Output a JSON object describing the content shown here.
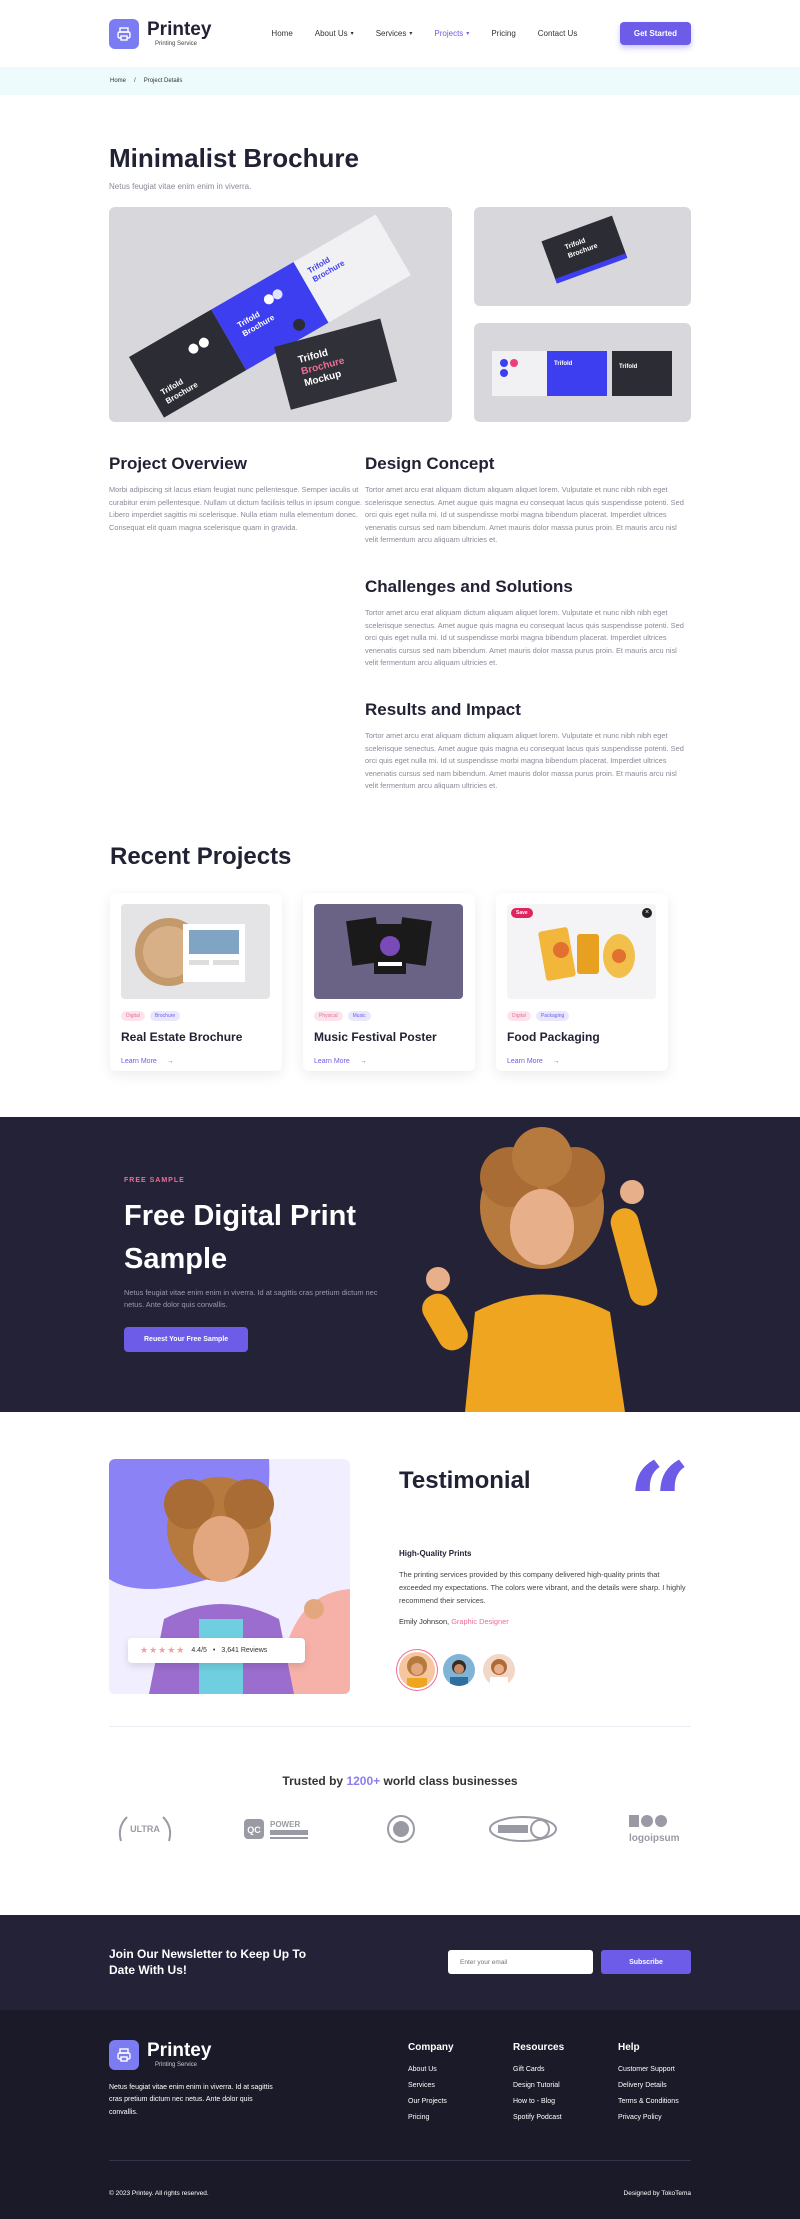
{
  "brand": {
    "name": "Printey",
    "tagline": "Printing Service"
  },
  "nav": {
    "items": [
      {
        "label": "Home",
        "has_dropdown": false,
        "active": false
      },
      {
        "label": "About Us",
        "has_dropdown": true,
        "active": false
      },
      {
        "label": "Services",
        "has_dropdown": true,
        "active": false
      },
      {
        "label": "Projects",
        "has_dropdown": true,
        "active": true
      },
      {
        "label": "Pricing",
        "has_dropdown": false,
        "active": false
      },
      {
        "label": "Contact Us",
        "has_dropdown": false,
        "active": false
      }
    ],
    "cta": "Get Started"
  },
  "breadcrumb": {
    "home": "Home",
    "separator": "/",
    "current": "Project Details"
  },
  "project": {
    "title": "Minimalist Brochure",
    "subtitle": "Netus feugiat vitae enim enim in viverra.",
    "mockup_text": "Trifold Brochure Mockup",
    "overview_title": "Project Overview",
    "overview_text": "Morbi adipiscing sit lacus etiam feugiat nunc pellentesque. Semper iaculis ut curabitur enim pellentesque. Nullam ut dictum facilisis tellus in ipsum congue. Libero imperdiet sagittis mi scelerisque. Nulla etiam nulla elementum donec. Consequat elit quam magna scelerisque quam in gravida.",
    "sections": [
      {
        "title": "Design Concept",
        "text": "Tortor amet arcu erat aliquam dictum aliquam aliquet lorem. Vulputate et nunc nibh nibh eget scelerisque senectus. Amet augue quis magna eu consequat lacus quis suspendisse potenti. Sed orci quis eget nulla mi. Id ut suspendisse morbi magna bibendum placerat. Imperdiet ultrices venenatis cursus sed nam bibendum. Amet mauris dolor massa purus proin. Et mauris arcu nisl velit fermentum arcu aliquam ultricies et."
      },
      {
        "title": "Challenges and Solutions",
        "text": "Tortor amet arcu erat aliquam dictum aliquam aliquet lorem. Vulputate et nunc nibh nibh eget scelerisque senectus. Amet augue quis magna eu consequat lacus quis suspendisse potenti. Sed orci quis eget nulla mi. Id ut suspendisse morbi magna bibendum placerat. Imperdiet ultrices venenatis cursus sed nam bibendum. Amet mauris dolor massa purus proin. Et mauris arcu nisl velit fermentum arcu aliquam ultricies et."
      },
      {
        "title": "Results and Impact",
        "text": "Tortor amet arcu erat aliquam dictum aliquam aliquet lorem. Vulputate et nunc nibh nibh eget scelerisque senectus. Amet augue quis magna eu consequat lacus quis suspendisse potenti. Sed orci quis eget nulla mi. Id ut suspendisse morbi magna bibendum placerat. Imperdiet ultrices venenatis cursus sed nam bibendum. Amet mauris dolor massa purus proin. Et mauris arcu nisl velit fermentum arcu aliquam ultricies et."
      }
    ]
  },
  "recent": {
    "title": "Recent Projects",
    "cards": [
      {
        "tags": [
          "Digital",
          "Brochure"
        ],
        "title": "Real Estate Brochure",
        "link": "Learn More"
      },
      {
        "tags": [
          "Physical",
          "Music"
        ],
        "title": "Music Festival Poster",
        "link": "Learn More"
      },
      {
        "tags": [
          "Digital",
          "Packaging"
        ],
        "title": "Food Packaging",
        "link": "Learn More"
      }
    ],
    "save_badge": "Save"
  },
  "promo": {
    "eyebrow": "FREE SAMPLE",
    "title": "Free Digital Print Sample",
    "text": "Netus feugiat vitae enim enim in viverra. Id at sagittis cras pretium dictum nec netus. Ante dolor quis convallis.",
    "button": "Reuest Your Free Sample"
  },
  "testimonial": {
    "title": "Testimonial",
    "quote_mark": "“",
    "heading": "High-Quality Prints",
    "body": "The printing services provided by this company delivered high-quality prints that exceeded my expectations. The colors were vibrant, and the details were sharp. I highly recommend their services.",
    "author": "Emily Johnson,",
    "role": "Graphic Designer",
    "rating_stars": "★★★★★",
    "rating": "4.4/5",
    "reviews": "3,641 Reviews",
    "rating_sep": "•"
  },
  "trusted": {
    "prefix": "Trusted by",
    "highlight": "1200+",
    "suffix": "world class businesses",
    "logos": [
      "ULTRA",
      "POWER",
      "",
      "",
      "logoipsum"
    ]
  },
  "newsletter": {
    "title": "Join Our Newsletter to Keep Up To Date With Us!",
    "placeholder": "Enter your email",
    "button": "Subscribe"
  },
  "footer": {
    "description": "Netus feugiat vitae enim enim in viverra. Id at sagittis cras pretium dictum nec netus. Ante dolor quis convallis.",
    "columns": [
      {
        "title": "Company",
        "links": [
          "About Us",
          "Services",
          "Our Projects",
          "Pricing"
        ]
      },
      {
        "title": "Resources",
        "links": [
          "Gift Cards",
          "Design Tutorial",
          "How to - Blog",
          "Spotify Podcast"
        ]
      },
      {
        "title": "Help",
        "links": [
          "Customer Support",
          "Delivery Details",
          "Terms & Conditions",
          "Privacy Policy"
        ]
      }
    ],
    "copyright": "© 2023 Printey. All rights reserved.",
    "designed_by": "Designed by TokoTema"
  },
  "colors": {
    "accent": "#6c5ce7",
    "pink": "#ef6d94",
    "dark": "#232237"
  }
}
